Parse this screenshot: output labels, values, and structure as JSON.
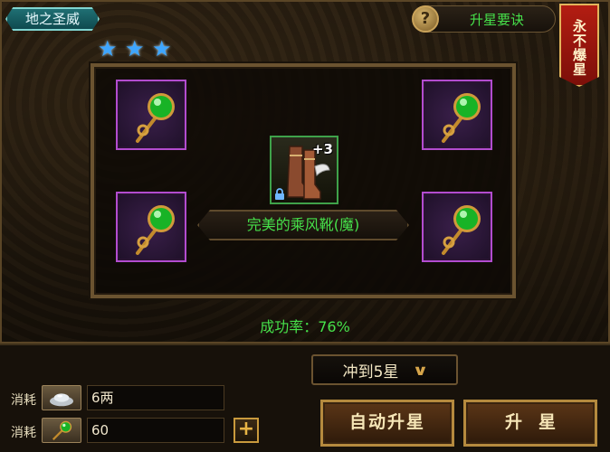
{
  "header": {
    "title": "地之圣威",
    "stars": [
      "★",
      "★",
      "★"
    ],
    "rules_button": "升星要诀",
    "rules_icon": "?",
    "banner": "永不爆星"
  },
  "upgrade": {
    "item_name": "完美的乘风靴(魔)",
    "item_level": "+3",
    "success_rate": "成功率：76%"
  },
  "controls": {
    "target_select": "冲到5星",
    "cost_label_1": "消耗",
    "cost_value_1": "6两",
    "cost_label_2": "消耗",
    "cost_value_2": "60",
    "plus_label": "+",
    "auto_button": "自动升星",
    "upgrade_button": "升星"
  },
  "colors": {
    "accent_green": "#46e04a",
    "star_blue": "#3ea6ff",
    "slot_purple": "#b24ccf",
    "gold": "#c99a3d"
  },
  "icons": {
    "gem": "green-gem-scepter-icon",
    "boots": "winged-boots-icon",
    "silver": "silver-ingot-icon",
    "lock": "lock-icon"
  }
}
